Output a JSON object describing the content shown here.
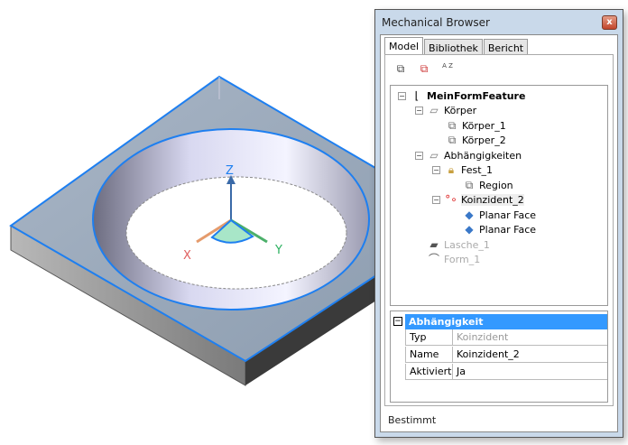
{
  "panel": {
    "title": "Mechanical Browser",
    "close_label": "x"
  },
  "tabs": [
    {
      "label": "Model"
    },
    {
      "label": "Bibliothek"
    },
    {
      "label": "Bericht"
    }
  ],
  "toolbar": {
    "icons": [
      "expand-tree-icon",
      "collapse-tree-icon",
      "sort-az-icon"
    ],
    "sort_label": "A Z"
  },
  "tree": [
    {
      "label": "MeinFormFeature",
      "level": 0
    },
    {
      "label": "Körper",
      "level": 1
    },
    {
      "label": "Körper_1",
      "level": 2
    },
    {
      "label": "Körper_2",
      "level": 2
    },
    {
      "label": "Abhängigkeiten",
      "level": 1
    },
    {
      "label": "Fest_1",
      "level": 2
    },
    {
      "label": "Region",
      "level": 3
    },
    {
      "label": "Koinzident_2",
      "level": 2
    },
    {
      "label": "Planar Face",
      "level": 3
    },
    {
      "label": "Planar Face",
      "level": 3
    },
    {
      "label": "Lasche_1",
      "level": 1
    },
    {
      "label": "Form_1",
      "level": 1
    }
  ],
  "properties": {
    "header": "Abhängigkeit",
    "rows": [
      {
        "key": "Typ",
        "value": "Koinzident"
      },
      {
        "key": "Name",
        "value": "Koinzident_2"
      },
      {
        "key": "Aktiviert",
        "value": "Ja"
      }
    ]
  },
  "status": "Bestimmt",
  "axes": {
    "x": "X",
    "y": "Y",
    "z": "Z"
  },
  "colors": {
    "selection": "#3399ff",
    "edge": "#1e7ff0"
  }
}
